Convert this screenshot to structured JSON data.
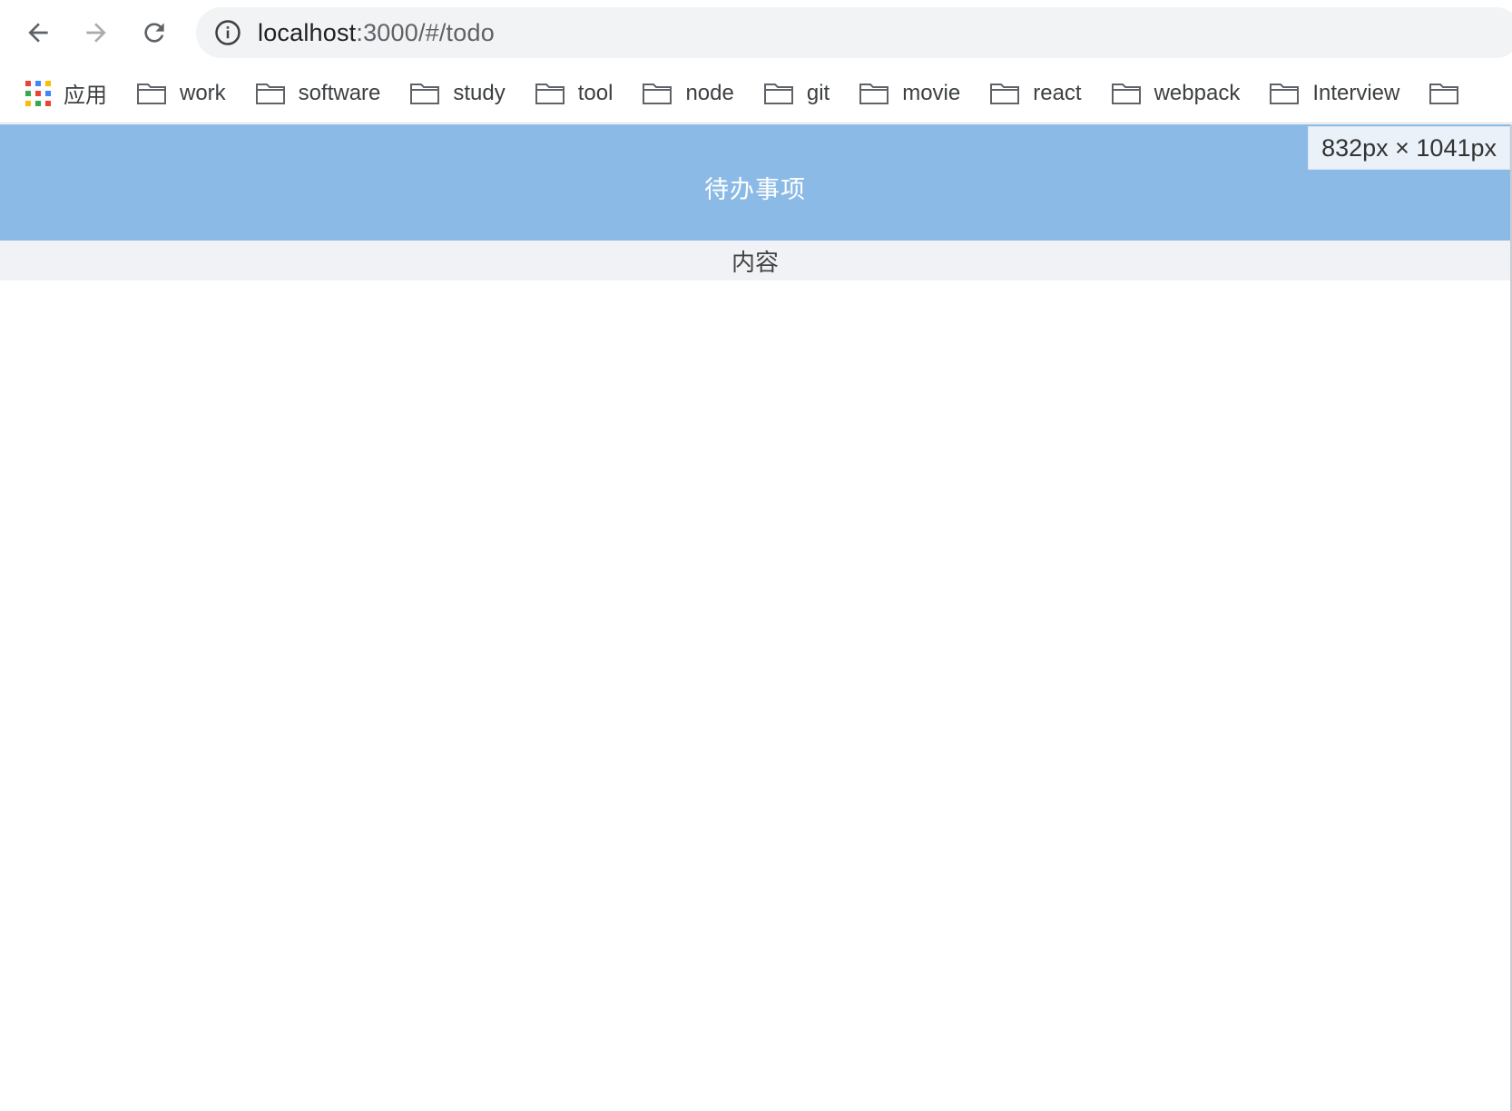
{
  "browser": {
    "url": {
      "host": "localhost",
      "path": ":3000/#/todo"
    },
    "bookmarks": {
      "apps_label": "应用",
      "items": [
        {
          "label": "work"
        },
        {
          "label": "software"
        },
        {
          "label": "study"
        },
        {
          "label": "tool"
        },
        {
          "label": "node"
        },
        {
          "label": "git"
        },
        {
          "label": "movie"
        },
        {
          "label": "react"
        },
        {
          "label": "webpack"
        },
        {
          "label": "Interview"
        },
        {
          "label": ""
        }
      ]
    }
  },
  "page": {
    "header_title": "待办事项",
    "content_label": "内容",
    "size_badge": "832px × 1041px"
  },
  "colors": {
    "header_bg": "#8bbae6",
    "content_bar_bg": "#f0f2f5"
  },
  "icons": {
    "back": "arrow-left-icon",
    "forward": "arrow-right-icon",
    "reload": "reload-icon",
    "info": "info-icon",
    "apps": "apps-grid-icon",
    "folder": "folder-icon"
  }
}
